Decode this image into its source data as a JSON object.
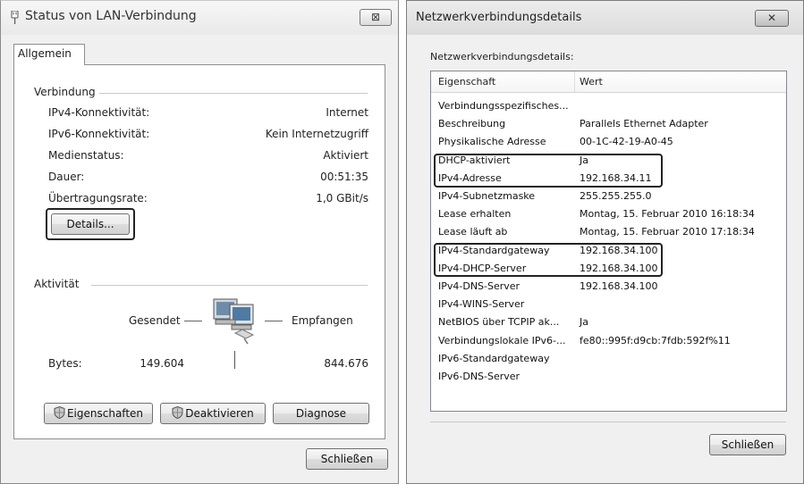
{
  "left_window": {
    "title": "Status von LAN-Verbindung",
    "close_glyph": "⊠",
    "tab": "Allgemein",
    "connection_group": "Verbindung",
    "connection_rows": [
      {
        "label": "IPv4-Konnektivität:",
        "value": "Internet"
      },
      {
        "label": "IPv6-Konnektivität:",
        "value": "Kein Internetzugriff"
      },
      {
        "label": "Medienstatus:",
        "value": "Aktiviert"
      },
      {
        "label": "Dauer:",
        "value": "00:51:35"
      },
      {
        "label": "Übertragungsrate:",
        "value": "1,0 GBit/s"
      }
    ],
    "details_button": "Details...",
    "activity_group": "Aktivität",
    "sent_label": "Gesendet",
    "received_label": "Empfangen",
    "bytes_label": "Bytes:",
    "bytes_sent": "149.604",
    "bytes_received": "844.676",
    "properties_button": "Eigenschaften",
    "disable_button": "Deaktivieren",
    "diagnose_button": "Diagnose",
    "close_button": "Schließen",
    "icons": {
      "title": "network-plug-icon",
      "shield": "uac-shield-icon",
      "network": "network-computers-icon"
    }
  },
  "right_window": {
    "title": "Netzwerkverbindungsdetails",
    "close_glyph": "✕",
    "subtitle": "Netzwerkverbindungsdetails:",
    "col_property": "Eigenschaft",
    "col_value": "Wert",
    "rows": [
      {
        "property": "Verbindungsspezifisches...",
        "value": ""
      },
      {
        "property": "Beschreibung",
        "value": "Parallels Ethernet Adapter"
      },
      {
        "property": "Physikalische Adresse",
        "value": "00-1C-42-19-A0-45"
      },
      {
        "property": "DHCP-aktiviert",
        "value": "Ja"
      },
      {
        "property": "IPv4-Adresse",
        "value": "192.168.34.11"
      },
      {
        "property": "IPv4-Subnetzmaske",
        "value": "255.255.255.0"
      },
      {
        "property": "Lease erhalten",
        "value": "Montag, 15. Februar 2010 16:18:34"
      },
      {
        "property": "Lease läuft ab",
        "value": "Montag, 15. Februar 2010 17:18:34"
      },
      {
        "property": "IPv4-Standardgateway",
        "value": "192.168.34.100"
      },
      {
        "property": "IPv4-DHCP-Server",
        "value": "192.168.34.100"
      },
      {
        "property": "IPv4-DNS-Server",
        "value": "192.168.34.100"
      },
      {
        "property": "IPv4-WINS-Server",
        "value": ""
      },
      {
        "property": "NetBIOS über TCPIP ak...",
        "value": "Ja"
      },
      {
        "property": "Verbindungslokale IPv6-...",
        "value": "fe80::995f:d9cb:7fdb:592f%11"
      },
      {
        "property": "IPv6-Standardgateway",
        "value": ""
      },
      {
        "property": "IPv6-DNS-Server",
        "value": ""
      }
    ],
    "close_button": "Schließen",
    "highlight_color": "#222222"
  }
}
